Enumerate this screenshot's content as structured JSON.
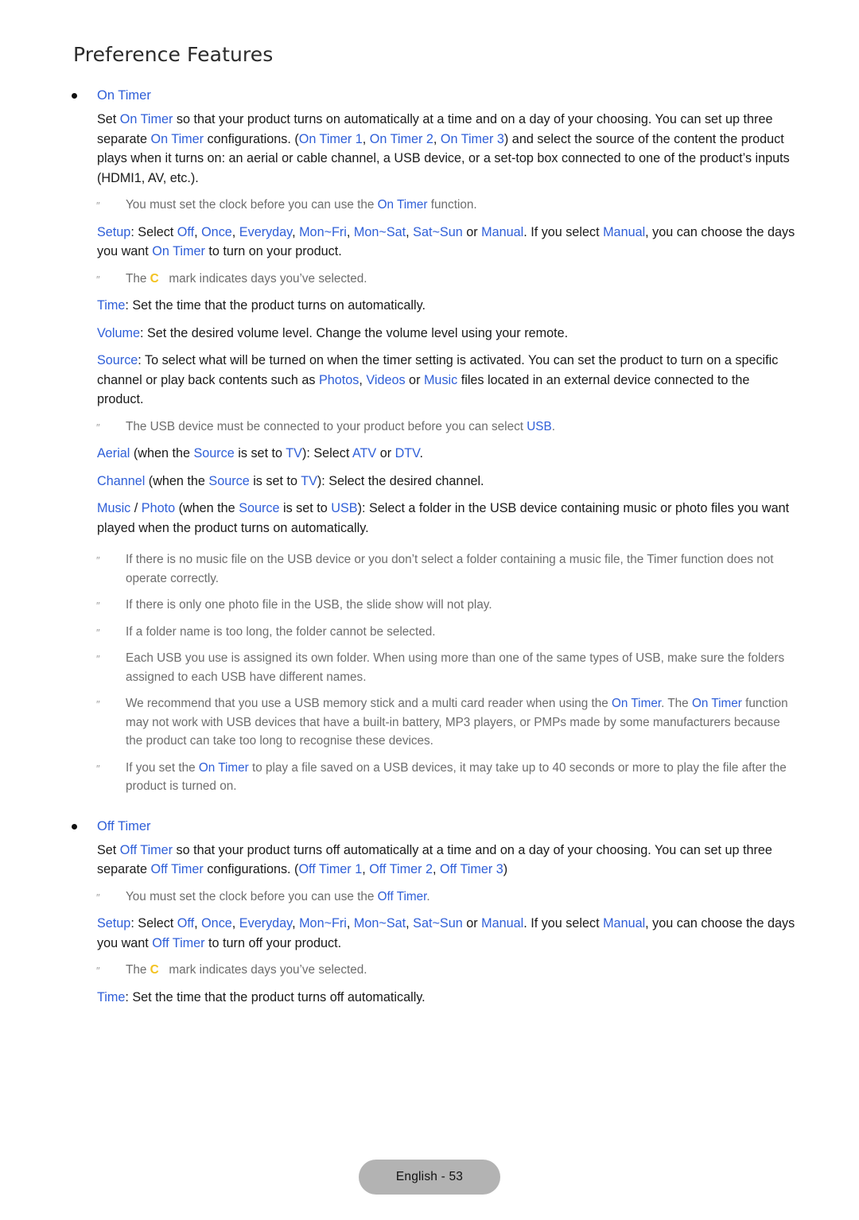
{
  "page": {
    "title": "Preference Features",
    "footer_label": "English - 53"
  },
  "colors": {
    "link_blue": "#2f5fd8",
    "note_grey": "#6d6d6d",
    "check_gold": "#f3c220",
    "footer_pill": "#b3b3b3",
    "body_text": "#1a1a1a"
  },
  "icons": {
    "bullet": "round-bullet-icon",
    "note_bullet": "note-double-prime-icon",
    "check_mark": "check-mark-glyph"
  },
  "sections": {
    "on_timer": {
      "heading": "On Timer",
      "intro": {
        "s1": "Set ",
        "k1": "On Timer",
        "s2": " so that your product turns on automatically at a time and on a day of your choosing. You can set up three separate ",
        "k2": "On Timer",
        "s3": " configurations. (",
        "k3": "On Timer 1",
        "s4": ", ",
        "k4": "On Timer 2",
        "s5": ", ",
        "k5": "On Timer 3",
        "s6": ") and select the source of the content the product plays when it turns on: an aerial or cable channel, a USB device, or a set-top box connected to one of the product’s inputs (HDMI1, AV, etc.)."
      },
      "note_clock": {
        "s1": "You must set the clock before you can use the ",
        "k1": "On Timer",
        "s2": " function."
      },
      "setup": {
        "k0": "Setup",
        "s0": ": Select ",
        "k1": "Off",
        "s1": ", ",
        "k2": "Once",
        "s2": ", ",
        "k3": "Everyday",
        "s3": ", ",
        "k4": "Mon~Fri",
        "s4": ", ",
        "k5": "Mon~Sat",
        "s5": ", ",
        "k6": "Sat~Sun",
        "s6": " or ",
        "k7": "Manual",
        "s7": ". If you select ",
        "k8": "Manual",
        "s8": ", you can choose the days you want ",
        "k9": "On Timer",
        "s9": " to turn on your product."
      },
      "note_check": {
        "s1": "The ",
        "mark": "C",
        "s2": " mark indicates days you’ve selected."
      },
      "time": {
        "k0": "Time",
        "s0": ": Set the time that the product turns on automatically."
      },
      "volume": {
        "k0": "Volume",
        "s0": ": Set the desired volume level. Change the volume level using your remote."
      },
      "source": {
        "k0": "Source",
        "s0": ": To select what will be turned on when the timer setting is activated. You can set the product to turn on a specific channel or play back contents such as ",
        "k1": "Photos",
        "s1": ", ",
        "k2": "Videos",
        "s2": " or ",
        "k3": "Music",
        "s3": " files located in an external device connected to the product."
      },
      "note_usb": {
        "s1": "The USB device must be connected to your product before you can select ",
        "k1": "USB",
        "s2": "."
      },
      "aerial": {
        "k0": "Aerial",
        "s0": " (when the ",
        "k1": "Source",
        "s1": " is set to ",
        "k2": "TV",
        "s2": "): Select ",
        "k3": "ATV",
        "s3": " or ",
        "k4": "DTV",
        "s4": "."
      },
      "channel": {
        "k0": "Channel",
        "s0": " (when the ",
        "k1": "Source",
        "s1": " is set to ",
        "k2": "TV",
        "s2": "): Select the desired channel."
      },
      "music_photo": {
        "k0": "Music",
        "s0": " / ",
        "k1": "Photo",
        "s1": " (when the ",
        "k2": "Source",
        "s2": " is set to ",
        "k3": "USB",
        "s3": "): Select a folder in the USB device containing music or photo files you want played when the product turns on automatically."
      },
      "notes": [
        "If there is no music file on the USB device or you don’t select a folder containing a music file, the Timer function does not operate correctly.",
        "If there is only one photo file in the USB, the slide show will not play.",
        "If a folder name is too long, the folder cannot be selected.",
        "Each USB you use is assigned its own folder. When using more than one of the same types of USB, make sure the folders assigned to each USB have different names."
      ],
      "note_recommend": {
        "s1": "We recommend that you use a USB memory stick and a multi card reader when using the ",
        "k1": "On Timer",
        "s2": ". The ",
        "k2": "On Timer",
        "s3": " function may not work with USB devices that have a built-in battery, MP3 players, or PMPs made by some manufacturers because the product can take too long to recognise these devices."
      },
      "note_delay": {
        "s1": "If you set the ",
        "k1": "On Timer",
        "s2": " to play a file saved on a USB devices, it may take up to 40 seconds or more to play the file after the product is turned on."
      }
    },
    "off_timer": {
      "heading": "Off Timer",
      "intro": {
        "s1": "Set ",
        "k1": "Off Timer",
        "s2": " so that your product turns off automatically at a time and on a day of your choosing. You can set up three separate ",
        "k2": "Off Timer",
        "s3": " configurations. (",
        "k3": "Off Timer 1",
        "s4": ", ",
        "k4": "Off Timer 2",
        "s5": ", ",
        "k5": "Off Timer 3",
        "s6": ")"
      },
      "note_clock": {
        "s1": "You must set the clock before you can use the ",
        "k1": "Off Timer",
        "s2": "."
      },
      "setup": {
        "k0": "Setup",
        "s0": ": Select ",
        "k1": "Off",
        "s1": ", ",
        "k2": "Once",
        "s2": ", ",
        "k3": "Everyday",
        "s3": ", ",
        "k4": "Mon~Fri",
        "s4": ", ",
        "k5": "Mon~Sat",
        "s5": ", ",
        "k6": "Sat~Sun",
        "s6": " or ",
        "k7": "Manual",
        "s7": ". If you select ",
        "k8": "Manual",
        "s8": ", you can choose the days you want ",
        "k9": "Off Timer",
        "s9": " to turn off your product."
      },
      "note_check": {
        "s1": "The ",
        "mark": "C",
        "s2": " mark indicates days you’ve selected."
      },
      "time": {
        "k0": "Time",
        "s0": ": Set the time that the product turns off automatically."
      }
    }
  }
}
